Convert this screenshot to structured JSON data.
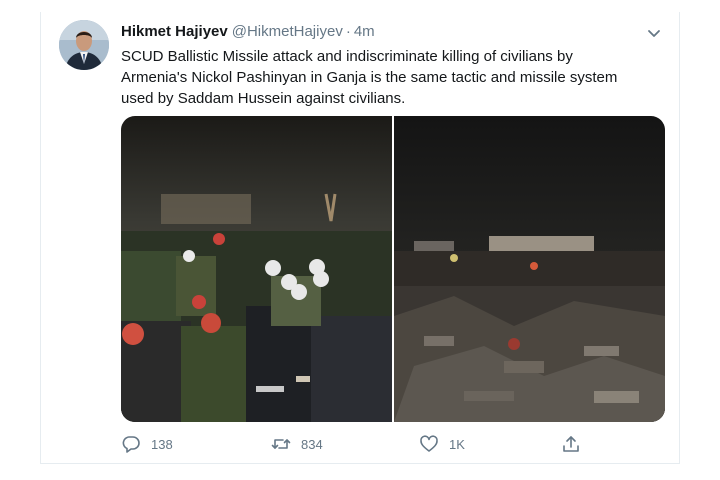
{
  "tweet": {
    "display_name": "Hikmet Hajiyev",
    "handle": "@HikmetHajiyev",
    "separator": "·",
    "time": "4m",
    "text": "SCUD Ballistic Missile attack and indiscriminate killing of civilians by\nArmenia's Nickol Pashinyan in Ganja is the same tactic and missile system\nused by Saddam Hussein against civilians."
  },
  "actions": {
    "reply_count": "138",
    "retweet_count": "834",
    "like_count": "1K"
  },
  "colors": {
    "text_primary": "#14171a",
    "text_secondary": "#657786",
    "border": "#e6ecf0"
  },
  "icons": {
    "menu": "chevron-down-icon",
    "reply": "reply-icon",
    "retweet": "retweet-icon",
    "like": "heart-icon",
    "share": "share-icon"
  }
}
